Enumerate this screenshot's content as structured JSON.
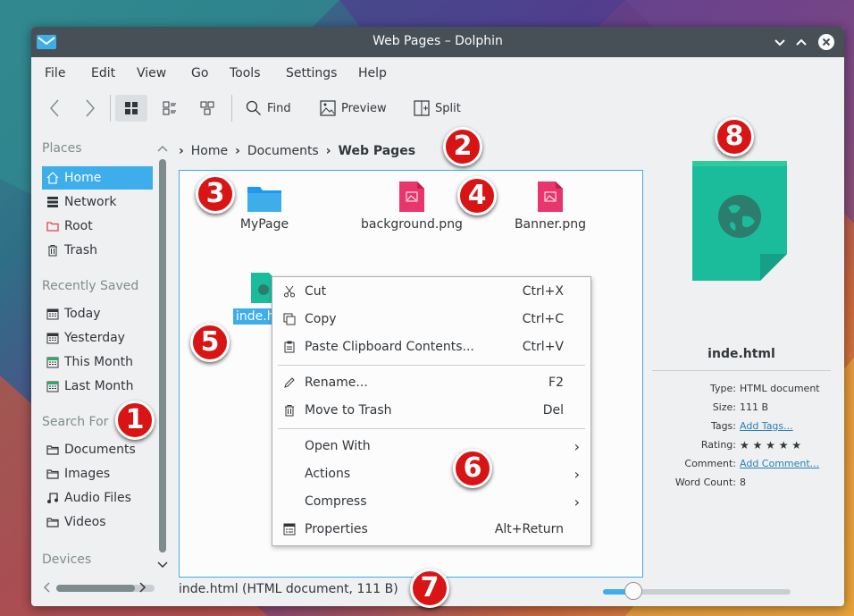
{
  "window": {
    "title": "Web Pages – Dolphin"
  },
  "menubar": [
    "File",
    "Edit",
    "View",
    "Go",
    "Tools",
    "Settings",
    "Help"
  ],
  "toolbar": {
    "find_label": "Find",
    "preview_label": "Preview",
    "split_label": "Split"
  },
  "sidebar": {
    "places_header": "Places",
    "places": [
      {
        "label": "Home",
        "icon": "home-icon"
      },
      {
        "label": "Network",
        "icon": "network-icon"
      },
      {
        "label": "Root",
        "icon": "folder-red-icon"
      },
      {
        "label": "Trash",
        "icon": "trash-icon"
      }
    ],
    "recent_header": "Recently Saved",
    "recent": [
      {
        "label": "Today",
        "icon": "calendar-icon"
      },
      {
        "label": "Yesterday",
        "icon": "calendar-icon"
      },
      {
        "label": "This Month",
        "icon": "calendar-icon"
      },
      {
        "label": "Last Month",
        "icon": "calendar-icon"
      }
    ],
    "search_header": "Search For",
    "search": [
      {
        "label": "Documents",
        "icon": "folder-icon"
      },
      {
        "label": "Images",
        "icon": "folder-icon"
      },
      {
        "label": "Audio Files",
        "icon": "music-icon"
      },
      {
        "label": "Videos",
        "icon": "folder-icon"
      }
    ],
    "devices_header": "Devices"
  },
  "breadcrumb": {
    "items": [
      "Home",
      "Documents",
      "Web Pages"
    ]
  },
  "files": [
    {
      "name": "MyPage",
      "type": "folder"
    },
    {
      "name": "background.png",
      "type": "image"
    },
    {
      "name": "Banner.png",
      "type": "image"
    },
    {
      "name": "inde.h",
      "type": "html",
      "selected": true
    }
  ],
  "context_menu": {
    "items": [
      {
        "label": "Cut",
        "shortcut": "Ctrl+X",
        "icon": "scissors-icon"
      },
      {
        "label": "Copy",
        "shortcut": "Ctrl+C",
        "icon": "copy-icon"
      },
      {
        "label": "Paste Clipboard Contents...",
        "shortcut": "Ctrl+V",
        "icon": "paste-icon"
      },
      {
        "label": "Rename...",
        "shortcut": "F2",
        "icon": "pencil-icon"
      },
      {
        "label": "Move to Trash",
        "shortcut": "Del",
        "icon": "trash-icon"
      },
      {
        "label": "Open With",
        "icon": ""
      },
      {
        "label": "Actions",
        "icon": ""
      },
      {
        "label": "Compress",
        "icon": ""
      },
      {
        "label": "Properties",
        "shortcut": "Alt+Return",
        "icon": "properties-icon"
      }
    ]
  },
  "statusbar": {
    "text": "inde.html (HTML document, 111 B)",
    "zoom_fraction": 0.16
  },
  "info_panel": {
    "filename": "inde.html",
    "rows": [
      {
        "key": "Type:",
        "value": "HTML document"
      },
      {
        "key": "Size:",
        "value": "111 B"
      },
      {
        "key": "Tags:",
        "value": "Add Tags..."
      },
      {
        "key": "Rating:",
        "value": "★ ★ ★ ★ ★"
      },
      {
        "key": "Comment:",
        "value": "Add Comment..."
      },
      {
        "key": "Word Count:",
        "value": "8"
      }
    ]
  },
  "callouts": [
    "1",
    "2",
    "3",
    "4",
    "5",
    "6",
    "7",
    "8"
  ],
  "colors": {
    "accent": "#3daee9",
    "titlebar": "#475057",
    "badge": "#d81414",
    "html_file": "#1abc9c",
    "image_file": "#e8356b"
  }
}
